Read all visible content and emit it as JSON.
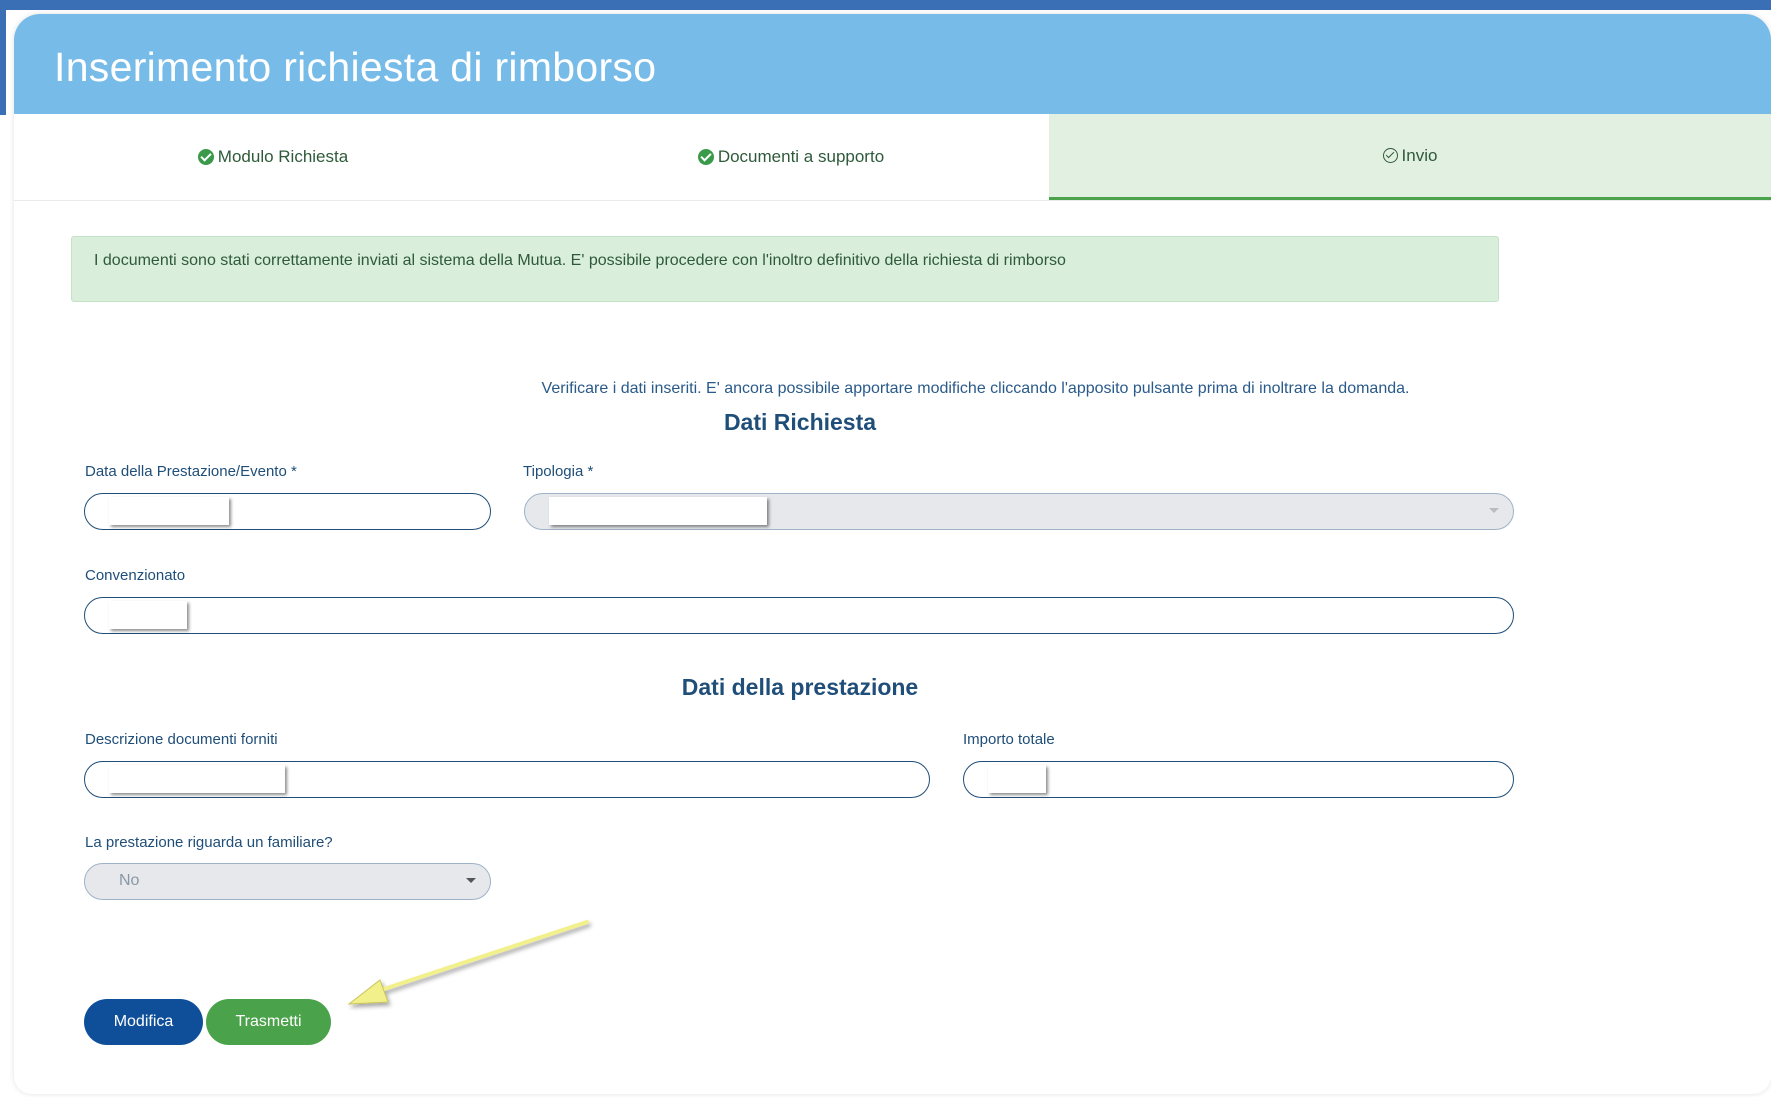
{
  "header": {
    "title": "Inserimento richiesta di rimborso"
  },
  "stepper": {
    "steps": [
      {
        "label": "Modulo Richiesta",
        "icon": "check-circle-filled-icon",
        "state": "done"
      },
      {
        "label": "Documenti a supporto",
        "icon": "check-circle-filled-icon",
        "state": "done"
      },
      {
        "label": "Invio",
        "icon": "check-circle-outline-icon",
        "state": "active"
      }
    ]
  },
  "alert": {
    "text": "I documenti sono stati correttamente inviati al sistema della Mutua. E' possibile procedere con l'inoltro definitivo della richiesta di rimborso"
  },
  "hint": "Verificare i dati inseriti. E' ancora possibile apportare modifiche cliccando l'apposito pulsante prima di inoltrare la domanda.",
  "dati_richiesta": {
    "title": "Dati Richiesta",
    "data_label": "Data della Prestazione/Evento *",
    "tipologia_label": "Tipologia *",
    "convenzionato_label": "Convenzionato"
  },
  "dati_prestazione": {
    "title": "Dati della prestazione",
    "descrizione_label": "Descrizione documenti forniti",
    "importo_label": "Importo totale",
    "familiare_label": "La prestazione riguarda un familiare?",
    "familiare_value": "No"
  },
  "buttons": {
    "modifica": "Modifica",
    "trasmetti": "Trasmetti"
  },
  "colors": {
    "header_bg": "#77bbe8",
    "primary": "#0f4f9a",
    "success": "#4aa24a",
    "alert_bg": "#d9eedb",
    "annotation_arrow": "#f2f08a"
  }
}
